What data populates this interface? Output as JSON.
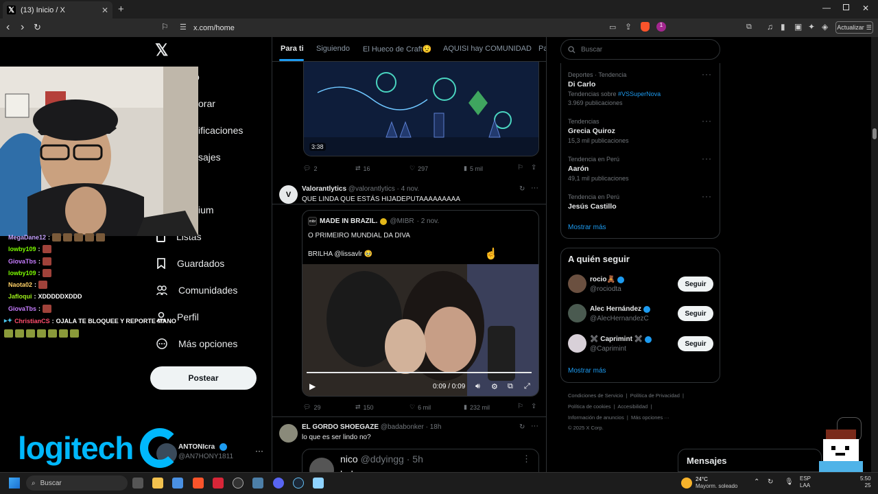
{
  "browser": {
    "tab_title": "(13) Inicio / X",
    "url": "x.com/home",
    "update_label": "Actualizar",
    "shield_count": "1"
  },
  "nav": {
    "items": [
      {
        "label": "Listas"
      },
      {
        "label": "Guardados"
      },
      {
        "label": "Comunidades"
      },
      {
        "label": "Perfil"
      },
      {
        "label": "Más opciones"
      }
    ],
    "partial": {
      "explore": "orar",
      "notifications": "ificaciones",
      "messages": "sajes",
      "premium": "ium",
      "home": "o"
    },
    "post_label": "Postear",
    "account": {
      "name": "ANTONIcra",
      "handle": "@AN7HONY1811"
    }
  },
  "feed": {
    "tabs": [
      "Para ti",
      "Siguiendo",
      "El Hueco de Craft😟",
      "AQUISI hay COMUNIDAD",
      "Pa"
    ],
    "tweet1": {
      "duration": "3:38",
      "replies": "2",
      "reposts": "16",
      "likes": "297",
      "views": "5 mil"
    },
    "tweet2": {
      "name": "Valorantlytics",
      "handle": "@valorantlytics",
      "time": "· 4 nov.",
      "text": "QUE LINDA QUE ESTÁS HIJADEPUTAAAAAAAAA",
      "quote": {
        "name": "MADE IN BRAZIL.",
        "handle": "@MIBR",
        "time": "· 2 nov.",
        "text1": "O PRIMEIRO MUNDIAL DA DIVA",
        "text2": "BRILHA @lissavlr 🥹",
        "video_time": "0:09 / 0:09"
      },
      "replies": "29",
      "reposts": "150",
      "likes": "6 mil",
      "views": "232 mil"
    },
    "tweet3": {
      "name": "EL GORDO SHOEGAZE",
      "handle": "@badabonker",
      "time": "· 18h",
      "text": "lo que es ser lindo no?",
      "quote": {
        "name": "nico",
        "handle": "@ddyingg",
        "time": "· 5h",
        "text": "hola"
      }
    }
  },
  "sidebar": {
    "search_placeholder": "Buscar",
    "trends": [
      {
        "sub": "Deportes · Tendencia",
        "main": "Di Carlo",
        "extra_prefix": "Tendencias sobre ",
        "extra_link": "#VSSuperNova",
        "count": "3.969 publicaciones"
      },
      {
        "sub": "Tendencias",
        "main": "Grecia Quiroz",
        "count": "15,3 mil publicaciones"
      },
      {
        "sub": "Tendencia en Perú",
        "main": "Aarón",
        "count": "49,1 mil publicaciones"
      },
      {
        "sub": "Tendencia en Perú",
        "main": "Jesús Castillo"
      }
    ],
    "show_more": "Mostrar más",
    "who_to_follow": {
      "title": "A quién seguir",
      "users": [
        {
          "name": "rocio🧸",
          "handle": "@rociodta"
        },
        {
          "name": "Alec Hernández",
          "handle": "@AlecHernandezC"
        },
        {
          "name": "✖️ Caprimint ✖️",
          "handle": "@Caprimint"
        }
      ],
      "follow_label": "Seguir",
      "show_more": "Mostrar más"
    },
    "footer": {
      "line1a": "Condiciones de Servicio",
      "line1b": "Política de Privacidad",
      "line2a": "Política de cookies",
      "line2b": "Accesibilidad",
      "line3a": "Información de anuncios",
      "line3b": "Más opciones ···",
      "line4": "© 2025 X Corp."
    },
    "messages": "Mensajes"
  },
  "stream": {
    "chat": [
      {
        "user": "MegaDane12",
        "msg": "",
        "color": "#c8a4ff"
      },
      {
        "user": "lowby109",
        "msg": "",
        "color": "#7cfc00"
      },
      {
        "user": "GiovaTbs",
        "msg": "",
        "color": "#c77dff"
      },
      {
        "user": "lowby109",
        "msg": "",
        "color": "#7cfc00"
      },
      {
        "user": "Naota02",
        "msg": "",
        "color": "#ffd166"
      },
      {
        "user": "Jafloqui",
        "msg": "XDDDDDXDDD",
        "color": "#9ef01a"
      },
      {
        "user": "GiovaTbs",
        "msg": "",
        "color": "#c77dff"
      },
      {
        "user": "ChristianCS",
        "msg": "OJALA TE BLOQUEE Y REPORTE MANO",
        "color": "#ff4d6d"
      }
    ],
    "brand": "logitech"
  },
  "taskbar": {
    "search": "Buscar",
    "weather_temp": "24°C",
    "weather_desc": "Mayorm. soleado",
    "lang1": "ESP",
    "lang2": "LAA",
    "time": "5:50",
    "date": "25"
  }
}
